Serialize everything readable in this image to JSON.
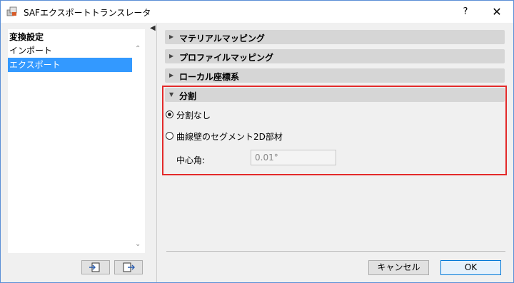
{
  "window": {
    "title": "SAFエクスポートトランスレータ"
  },
  "titlebar": {
    "help": "?",
    "close": "✕"
  },
  "left_panel": {
    "heading": "変換設定",
    "items": [
      {
        "label": "インポート",
        "selected": false
      },
      {
        "label": "エクスポート",
        "selected": true
      }
    ]
  },
  "sections": [
    {
      "label": "マテリアルマッピング",
      "expanded": false
    },
    {
      "label": "プロファイルマッピング",
      "expanded": false
    },
    {
      "label": "ローカル座標系",
      "expanded": false
    },
    {
      "label": "分割",
      "expanded": true
    }
  ],
  "split_options": {
    "no_split": "分割なし",
    "curved_wall": "曲線壁のセグメント2D部材",
    "selected": "no_split"
  },
  "center_angle": {
    "label": "中心角:",
    "value": "0.01°"
  },
  "buttons": {
    "cancel": "キャンセル",
    "ok": "OK"
  },
  "colors": {
    "selection": "#3399ff",
    "highlight": "#e32a2a",
    "ok_border": "#0078d7"
  }
}
